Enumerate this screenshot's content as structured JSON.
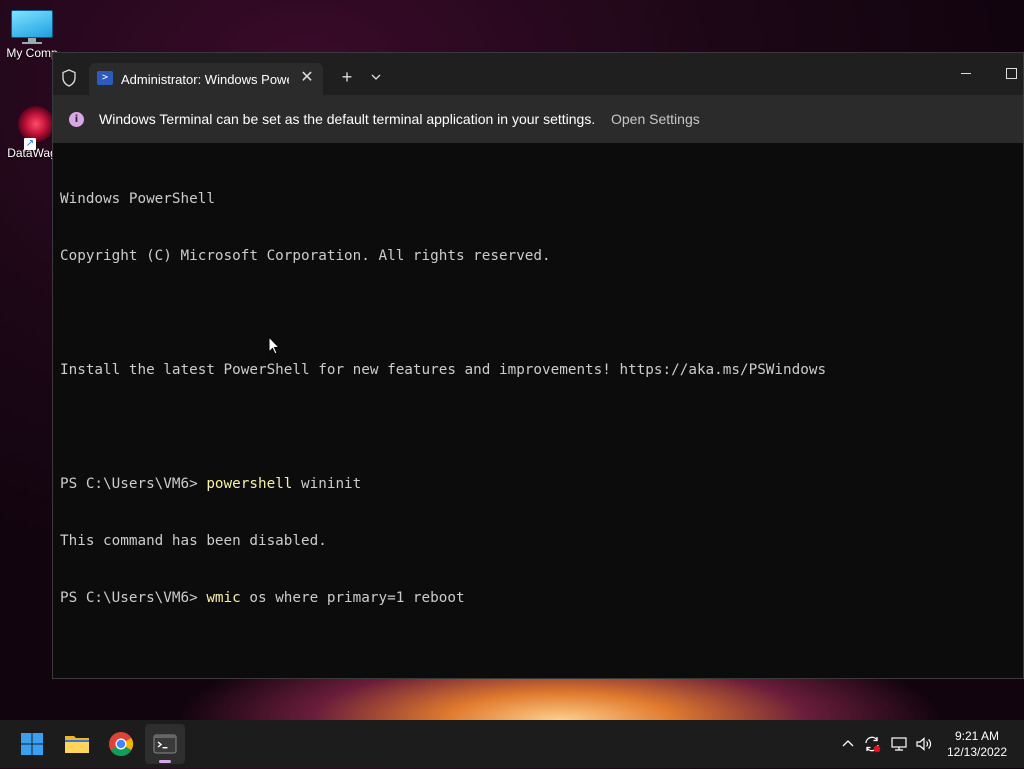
{
  "desktop": {
    "icons": [
      {
        "label": "My Comp"
      },
      {
        "label": "DataWag"
      }
    ]
  },
  "window": {
    "tab_title": "Administrator: Windows Powe",
    "tab_close": "✕",
    "new_tab": "+",
    "icons": [
      "shield-icon",
      "powershell-icon",
      "chevron-down-icon",
      "minimize-icon",
      "maximize-icon"
    ]
  },
  "infobar": {
    "message": "Windows Terminal can be set as the default terminal application in your settings.",
    "link": "Open Settings",
    "accent": "#d9a6e6"
  },
  "console": {
    "lines": [
      "Windows PowerShell",
      "Copyright (C) Microsoft Corporation. All rights reserved.",
      "",
      "Install the latest PowerShell for new features and improvements! https://aka.ms/PSWindows",
      "",
      "This command has been disabled."
    ],
    "prompt": "PS C:\\Users\\VM6> ",
    "cmd1_name": "powershell",
    "cmd1_args": " wininit",
    "cmd2_name": "wmic",
    "cmd2_args": " os where primary=1 reboot",
    "text_color": "#cccccc",
    "command_color": "#f9f1a5"
  },
  "taskbar": {
    "apps": [
      "windows-start-icon",
      "file-explorer-icon",
      "chrome-icon",
      "terminal-icon"
    ],
    "tray_icons": [
      "chevron-up-icon",
      "sync-icon",
      "network-icon",
      "volume-icon"
    ],
    "time": "9:21 AM",
    "date": "12/13/2022"
  }
}
